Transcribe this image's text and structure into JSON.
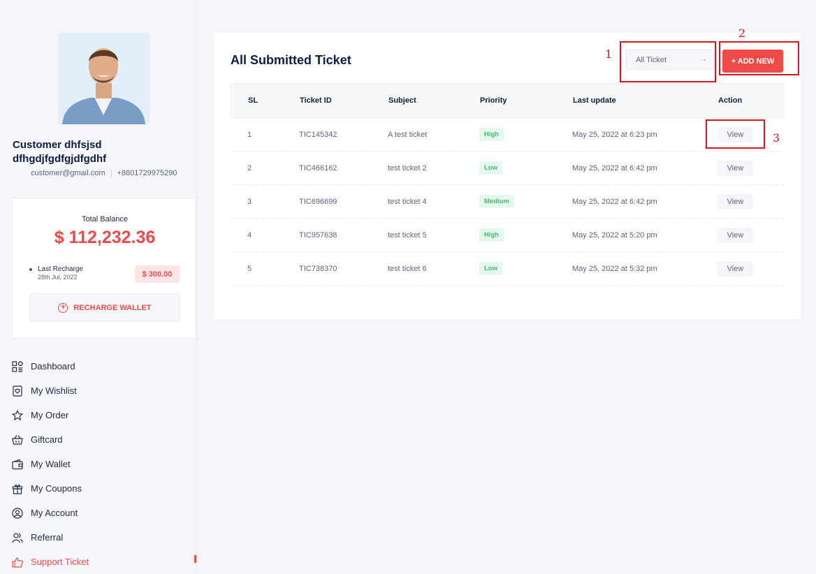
{
  "sidebar": {
    "customer_name": "Customer dhfsjsd dfhgdjfgdfgjdfgdhf",
    "email": "customer@gmail.com",
    "phone": "+8801729975290",
    "balance": {
      "label": "Total Balance",
      "amount": "$ 112,232.36",
      "last_recharge_label": "Last Recharge",
      "last_recharge_date": "28th Jul, 2022",
      "last_recharge_amount": "$ 300.00",
      "recharge_button": "RECHARGE WALLET"
    },
    "nav": [
      {
        "label": "Dashboard",
        "icon": "dashboard-icon"
      },
      {
        "label": "My Wishlist",
        "icon": "wishlist-icon"
      },
      {
        "label": "My Order",
        "icon": "star-icon"
      },
      {
        "label": "Giftcard",
        "icon": "basket-icon"
      },
      {
        "label": "My Wallet",
        "icon": "wallet-icon"
      },
      {
        "label": "My Coupons",
        "icon": "coupon-icon"
      },
      {
        "label": "My Account",
        "icon": "account-icon"
      },
      {
        "label": "Referral",
        "icon": "referral-icon"
      },
      {
        "label": "Support Ticket",
        "icon": "thumbs-up-icon",
        "active": true
      }
    ]
  },
  "main": {
    "title": "All Submitted Ticket",
    "filter_value": "All Ticket",
    "add_button": "+ ADD NEW",
    "table": {
      "headers": [
        "SL",
        "Ticket ID",
        "Subject",
        "Priority",
        "Last update",
        "Action"
      ],
      "rows": [
        {
          "sl": "1",
          "id": "TIC145342",
          "subject": "A test ticket",
          "priority": "High",
          "updated": "May 25, 2022 at 6:23 pm",
          "action": "View"
        },
        {
          "sl": "2",
          "id": "TIC466162",
          "subject": "test ticket 2",
          "priority": "Low",
          "updated": "May 25, 2022 at 6:42 pm",
          "action": "View"
        },
        {
          "sl": "3",
          "id": "TIC696699",
          "subject": "test ticket 4",
          "priority": "Medium",
          "updated": "May 25, 2022 at 6:42 pm",
          "action": "View"
        },
        {
          "sl": "4",
          "id": "TIC957638",
          "subject": "test ticket 5",
          "priority": "High",
          "updated": "May 25, 2022 at 5:20 pm",
          "action": "View"
        },
        {
          "sl": "5",
          "id": "TIC738370",
          "subject": "test ticket 6",
          "priority": "Low",
          "updated": "May 25, 2022 at 5:32 pm",
          "action": "View"
        }
      ]
    }
  },
  "annotations": {
    "one": "1",
    "two": "2",
    "three": "3"
  },
  "colors": {
    "accent": "#ee4a4a",
    "badge_bg": "#e6f8ee",
    "badge_text": "#3cbf6a",
    "annotation": "#d9141b"
  }
}
